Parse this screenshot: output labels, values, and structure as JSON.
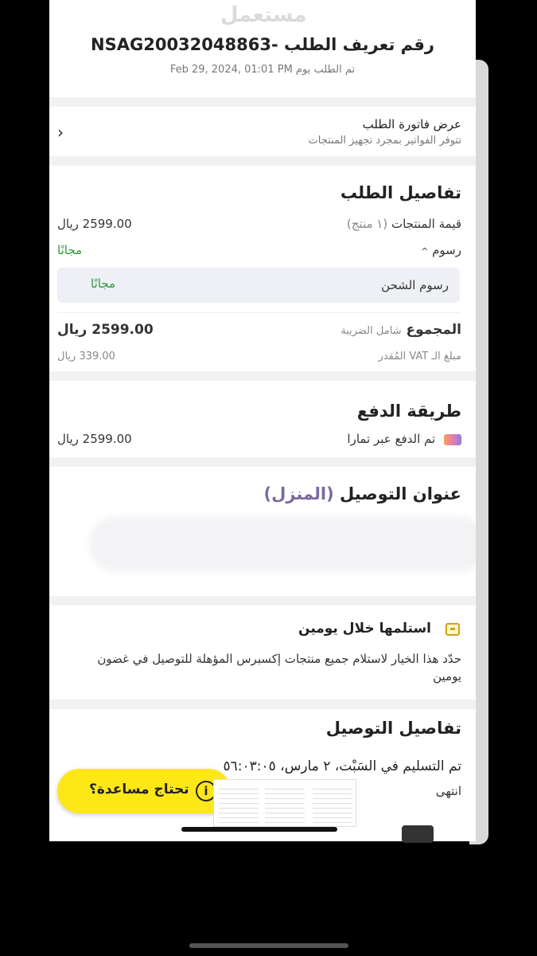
{
  "watermark": "مستعمل",
  "header": {
    "order_title": "رقم تعريف الطلب -NSAG20032048863",
    "order_date": "تم الطلب يوم Feb 29, 2024, 01:01 PM"
  },
  "invoice": {
    "title": "عرض فاتورة الطلب",
    "subtitle": "تتوفر الفواتير بمجرد تجهيز المنتجات",
    "chevron": "‹"
  },
  "order_details": {
    "heading": "تفاصيل الطلب",
    "products_label": "قيمة المنتجات",
    "products_count": "(١ منتج)",
    "products_value": "2599.00 ريال",
    "fees_label": "رسوم",
    "fees_caret": "^",
    "fees_value": "مجانًا",
    "shipping_label": "رسوم الشحن",
    "shipping_value": "مجانًا",
    "total_label": "المجموع",
    "total_note": "شامل الضريبة",
    "total_value": "2599.00 ريال",
    "vat_label": "مبلغ الـ VAT المُقدر",
    "vat_value": "339.00 ريال"
  },
  "payment": {
    "heading": "طريقة الدفع",
    "method_label": "تم الدفع عبر تمارا",
    "amount": "2599.00 ريال"
  },
  "address": {
    "heading": "عنوان التوصيل",
    "tag": "(المنزل)"
  },
  "express": {
    "title": "استلمها خلال يومين",
    "description": "حدّد هذا الخيار لاستلام جميع منتجات إكسبرس المؤهلة للتوصيل في غضون يومين"
  },
  "delivery": {
    "heading": "تفاصيل التوصيل",
    "delivered_text": "تم التسليم في السَبْت، ٢ مارس، ٥٦:٠٣:٠٥",
    "ended_text": "انتهى"
  },
  "help": {
    "label": "تحتاج مساعدة؟",
    "icon": "i"
  },
  "colors": {
    "accent_yellow": "#fee717",
    "free_green": "#2e9b3a",
    "address_tag": "#7a6aa0"
  }
}
